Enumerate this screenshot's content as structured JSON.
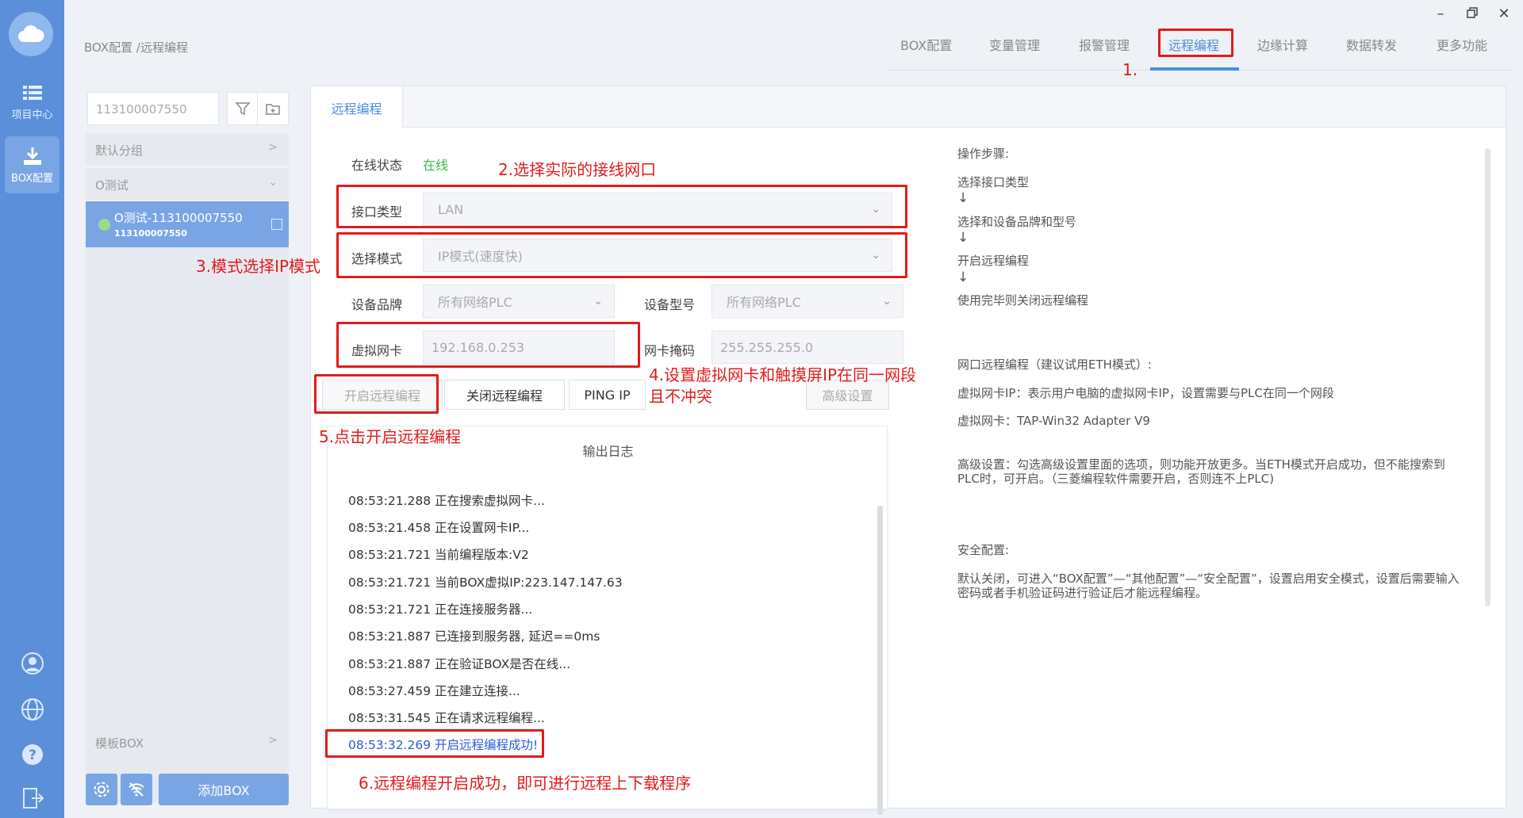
{
  "rail": {
    "items": [
      {
        "label": "项目中心",
        "icon": "list-icon"
      },
      {
        "label": "BOX配置",
        "icon": "download-icon"
      }
    ],
    "bottom_icons": [
      "user-icon",
      "globe-icon",
      "help-icon",
      "exit-icon"
    ]
  },
  "breadcrumb": "BOX配置 /远程编程",
  "topnav": [
    "BOX配置",
    "变量管理",
    "报警管理",
    "远程编程",
    "边缘计算",
    "数据转发",
    "更多功能"
  ],
  "topnav_active": "远程编程",
  "left": {
    "search_value": "113100007550",
    "groups": [
      "默认分组",
      "O测试"
    ],
    "device": {
      "name": "O测试-113100007550",
      "id": "113100007550",
      "status_color": "#9ddb8a"
    },
    "template_group": "模板BOX",
    "add_button": "添加BOX"
  },
  "main": {
    "tab": "远程编程",
    "online_label": "在线状态",
    "online_value": "在线",
    "interface_label": "接口类型",
    "interface_value": "LAN",
    "mode_label": "选择模式",
    "mode_value": "IP模式(速度快)",
    "brand_label": "设备品牌",
    "brand_value": "所有网络PLC",
    "model_label": "设备型号",
    "model_value": "所有网络PLC",
    "vnic_label": "虚拟网卡",
    "vnic_value": "192.168.0.253",
    "mask_label": "网卡掩码",
    "mask_value": "255.255.255.0",
    "buttons": {
      "start": "开启远程编程",
      "stop": "关闭远程编程",
      "ping": "PING IP",
      "advanced": "高级设置"
    },
    "log_title": "输出日志",
    "log_lines": [
      "08:53:21.288 正在搜索虚拟网卡...",
      "08:53:21.458 正在设置网卡IP...",
      "08:53:21.721 当前编程版本:V2",
      "08:53:21.721 当前BOX虚拟IP:223.147.147.63",
      "08:53:21.721 正在连接服务器...",
      "08:53:21.887 已连接到服务器, 延迟==0ms",
      "08:53:21.887 正在验证BOX是否在线...",
      "08:53:27.459 正在建立连接...",
      "08:53:31.545 正在请求远程编程...",
      "08:53:32.269 开启远程编程成功!"
    ]
  },
  "help": {
    "steps_title": "操作步骤:",
    "step1": "选择接口类型",
    "step2": "选择和设备品牌和型号",
    "step3": "开启远程编程",
    "step4": "使用完毕则关闭远程编程",
    "arrow": "↓",
    "eth_title": "网口远程编程（建议试用ETH模式）:",
    "eth_line1": "虚拟网卡IP：表示用户电脑的虚拟网卡IP，设置需要与PLC在同一个网段",
    "eth_line2": "虚拟网卡：TAP-Win32 Adapter V9",
    "adv_line1": "高级设置：勾选高级设置里面的选项，则功能开放更多。当ETH模式开启成功，但不能搜索到",
    "adv_line2": "PLC时，可开启。（三菱编程软件需要开启，否则连不上PLC)",
    "sec_title": "安全配置:",
    "sec_line1": "默认关闭，可进入“BOX配置”—“其他配置”—“安全配置”，设置启用安全模式，设置后需要输入",
    "sec_line2": "密码或者手机验证码进行验证后才能远程编程。"
  },
  "annotations": {
    "a1": "1.",
    "a2": "2.选择实际的接线网口",
    "a3": "3.模式选择IP模式",
    "a4_line1": "4.设置虚拟网卡和触摸屏IP在同一网段",
    "a4_line2": "且不冲突",
    "a5": "5.点击开启远程编程",
    "a6": "6.远程编程开启成功，即可进行远程上下载程序"
  },
  "colors": {
    "accent": "#4a8de0",
    "rail": "#5b8fd9",
    "annotation": "#e21b1b",
    "online": "#3cb64a",
    "success": "#2a5bd7"
  }
}
